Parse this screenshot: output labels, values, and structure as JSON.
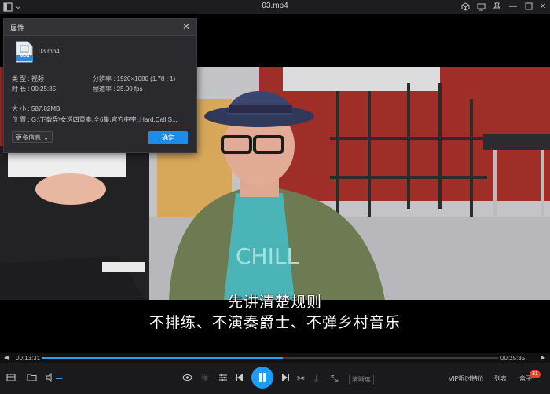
{
  "window": {
    "title": "03.mp4"
  },
  "dialog": {
    "title": "属性",
    "filename": "03.mp4",
    "file_badge": "MP4",
    "type_label": "类 型 : 视频",
    "resolution_label": "分辨率 : 1920×1080 (1.78 : 1)",
    "duration_label": "时 长 : 00:25:35",
    "framerate_label": "帧速率 : 25.00 fps",
    "size_label": "大 小 : 587.82MB",
    "location_label": "位 置 : G:\\下载盘\\女巡四重奏.全6集.官方中字..Hard.Cell.S...",
    "more_info_button": "更多信息",
    "ok_button": "确定"
  },
  "subtitles": {
    "line1": "先讲清楚规则",
    "line2": "不排练、不演奏爵士、不弹乡村音乐"
  },
  "playback": {
    "current_time": "00:13:31",
    "total_time": "00:25:35",
    "progress": 0.528
  },
  "controls": {
    "clarity_button": "清晰度",
    "vip_button": "VIP限时特价",
    "playlist_button": "列表",
    "box_label": "盒子",
    "box_badge": "31"
  },
  "colors": {
    "accent": "#1b9ef3",
    "badge": "#e8412c"
  }
}
